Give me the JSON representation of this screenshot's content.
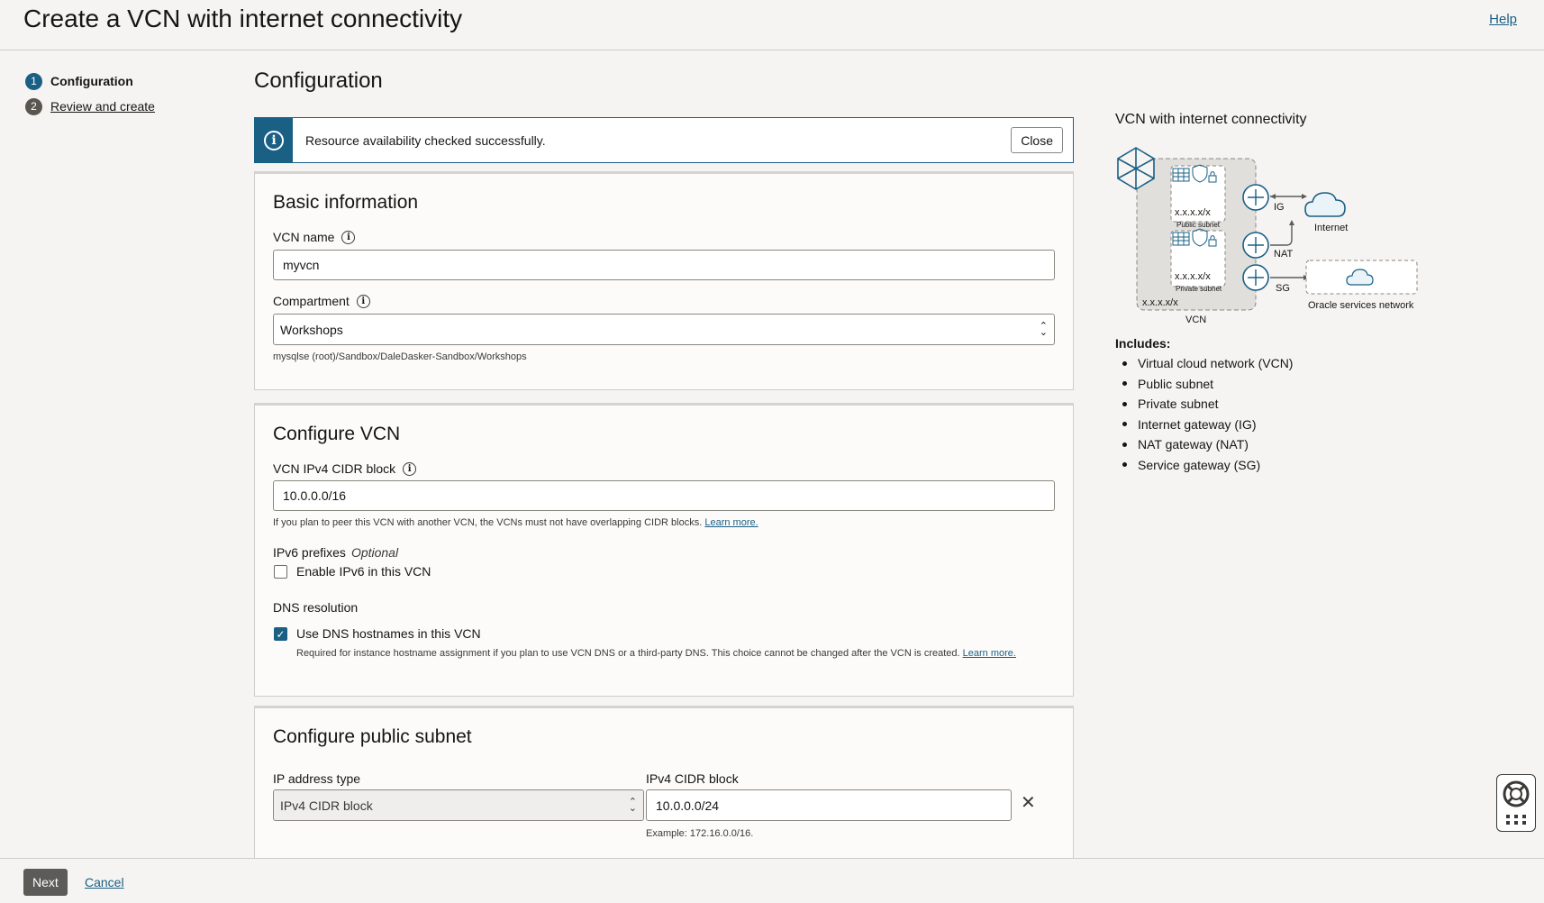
{
  "header": {
    "title": "Create a VCN with internet connectivity",
    "help": "Help"
  },
  "steps": [
    {
      "num": "1",
      "label": "Configuration"
    },
    {
      "num": "2",
      "label": "Review and create"
    }
  ],
  "main_title": "Configuration",
  "banner": {
    "text": "Resource availability checked successfully.",
    "close": "Close"
  },
  "basic": {
    "heading": "Basic information",
    "vcn_name_label": "VCN name",
    "vcn_name_value": "myvcn",
    "compartment_label": "Compartment",
    "compartment_value": "Workshops",
    "compartment_path": "mysqlse (root)/Sandbox/DaleDasker-Sandbox/Workshops"
  },
  "configure_vcn": {
    "heading": "Configure VCN",
    "cidr_label": "VCN IPv4 CIDR block",
    "cidr_value": "10.0.0.0/16",
    "cidr_hint": "If you plan to peer this VCN with another VCN, the VCNs must not have overlapping CIDR blocks.",
    "learn_more": "Learn more.",
    "ipv6_label": "IPv6 prefixes",
    "ipv6_optional": "Optional",
    "ipv6_checkbox": "Enable IPv6 in this VCN",
    "ipv6_checked": false,
    "dns_label": "DNS resolution",
    "dns_checkbox": "Use DNS hostnames in this VCN",
    "dns_checked": true,
    "dns_hint": "Required for instance hostname assignment if you plan to use VCN DNS or a third-party DNS. This choice cannot be changed after the VCN is created.",
    "dns_learn_more": "Learn more."
  },
  "public_subnet": {
    "heading": "Configure public subnet",
    "ip_type_label": "IP address type",
    "ip_type_value": "IPv4 CIDR block",
    "cidr_label": "IPv4 CIDR block",
    "cidr_value": "10.0.0.0/24",
    "cidr_example": "Example: 172.16.0.0/16."
  },
  "diagram": {
    "title": "VCN with internet connectivity",
    "labels": {
      "public_cidr": "x.x.x.x/x",
      "public_subnet": "Public subnet",
      "private_cidr": "x.x.x.x/x",
      "private_subnet": "Private subnet",
      "vcn_cidr": "x.x.x.x/x",
      "vcn": "VCN",
      "ig": "IG",
      "nat": "NAT",
      "sg": "SG",
      "internet": "Internet",
      "osn": "Oracle services network"
    }
  },
  "includes": {
    "heading": "Includes:",
    "items": [
      "Virtual cloud network (VCN)",
      "Public subnet",
      "Private subnet",
      "Internet gateway (IG)",
      "NAT gateway (NAT)",
      "Service gateway (SG)"
    ]
  },
  "footer": {
    "next": "Next",
    "cancel": "Cancel"
  },
  "colors": {
    "accent": "#1a5f84",
    "next_button": "#5c5b58"
  }
}
